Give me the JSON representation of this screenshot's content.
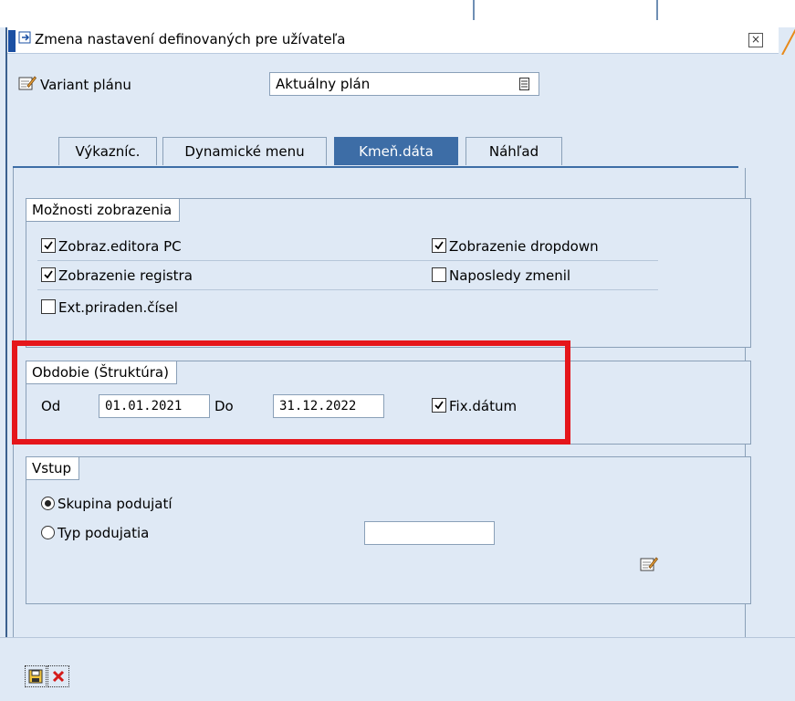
{
  "window": {
    "title": "Zmena nastavení definovaných pre užívateľa"
  },
  "variant": {
    "label": "Variant plánu",
    "value": "Aktuálny plán"
  },
  "tabs": [
    {
      "label": "Výkazníc.",
      "active": false
    },
    {
      "label": "Dynamické menu",
      "active": false
    },
    {
      "label": "Kmeň.dáta",
      "active": true
    },
    {
      "label": "Náhľad",
      "active": false
    }
  ],
  "display_options": {
    "title": "Možnosti zobrazenia",
    "items": [
      {
        "label": "Zobraz.editora PC",
        "checked": true
      },
      {
        "label": "Zobrazenie dropdown",
        "checked": true
      },
      {
        "label": "Zobrazenie registra",
        "checked": true
      },
      {
        "label": "Naposledy zmenil",
        "checked": false
      },
      {
        "label": "Ext.priraden.čísel",
        "checked": false
      }
    ]
  },
  "period": {
    "title": "Obdobie (Štruktúra)",
    "from_label": "Od",
    "from_value": "01.01.2021",
    "to_label": "Do",
    "to_value": "31.12.2022",
    "fixed_label": "Fix.dátum",
    "fixed_checked": true
  },
  "entry": {
    "title": "Vstup",
    "options": [
      {
        "label": "Skupina podujatí",
        "selected": true
      },
      {
        "label": "Typ podujatia",
        "selected": false
      }
    ],
    "type_value": ""
  },
  "colors": {
    "accent": "#3d6da6",
    "highlight": "#e5161b",
    "background": "#dfe9f5"
  }
}
